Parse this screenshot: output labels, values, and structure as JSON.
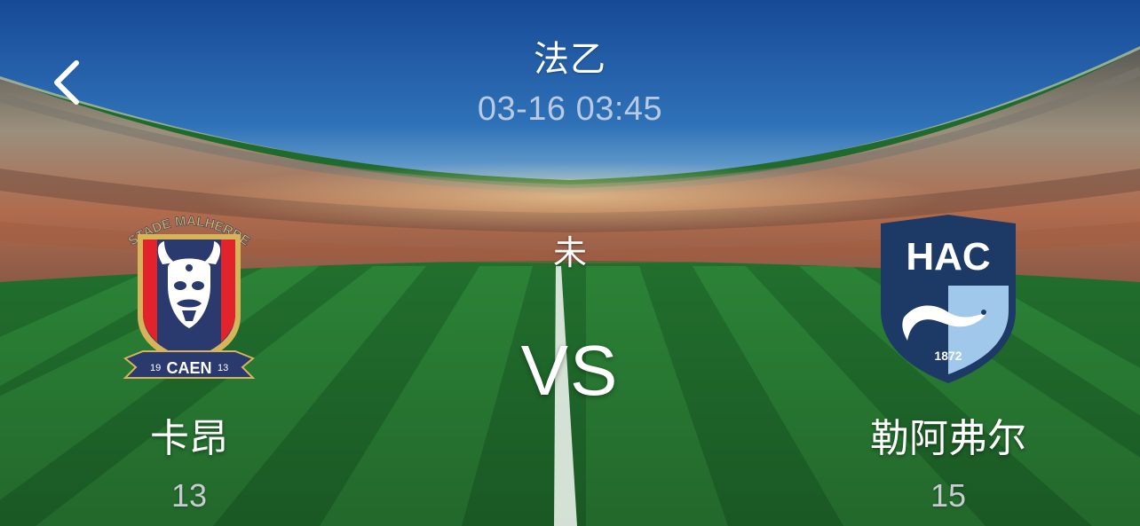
{
  "header": {
    "back_icon": "chevron-left-icon",
    "league": "法乙",
    "datetime": "03-16 03:45"
  },
  "match": {
    "status": "未",
    "vs_label": "VS",
    "home": {
      "name": "卡昂",
      "score": "13",
      "badge_text_top": "STADE MALHERBE",
      "badge_text_bottom": "CAEN",
      "badge_year_left": "19",
      "badge_year_right": "13",
      "badge_colors": {
        "blue": "#2b3a6e",
        "red": "#e3232c",
        "gold": "#d6b45a"
      }
    },
    "away": {
      "name": "勒阿弗尔",
      "score": "15",
      "badge_text_top": "HAC",
      "badge_year": "1872",
      "badge_colors": {
        "navy": "#1d3a66",
        "sky": "#9fc8ea"
      }
    }
  },
  "theme": {
    "sky_top": "#1b4f9a",
    "sky_bottom": "#3f86c8",
    "grass_dark": "#1f6a2c",
    "grass_light": "#2f8a3b"
  }
}
